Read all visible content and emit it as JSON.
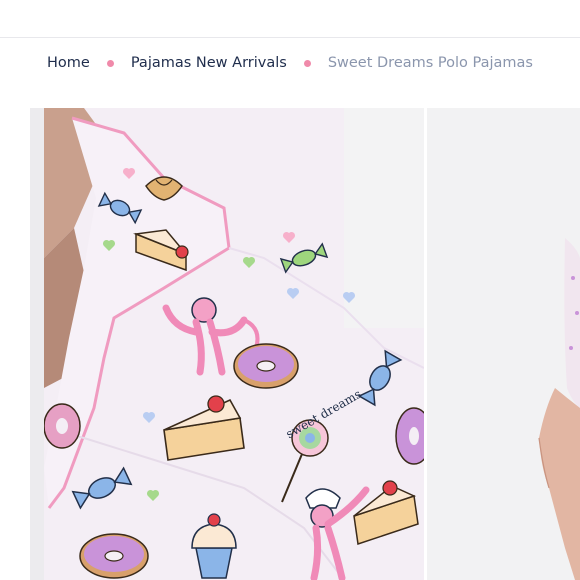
{
  "breadcrumb": {
    "items": [
      {
        "label": "Home"
      },
      {
        "label": "Pajamas New Arrivals"
      },
      {
        "label": "Sweet Dreams Polo Pajamas"
      }
    ],
    "separator_color": "#f08aaa",
    "link_color": "#1f2d4c",
    "current_color": "#8b96ad"
  },
  "gallery": {
    "main_image": {
      "subject": "pink pajama top with sweets pattern",
      "print_text": "sweet dreams"
    },
    "secondary_image": {
      "subject": "model wearing pajama shorts"
    }
  }
}
